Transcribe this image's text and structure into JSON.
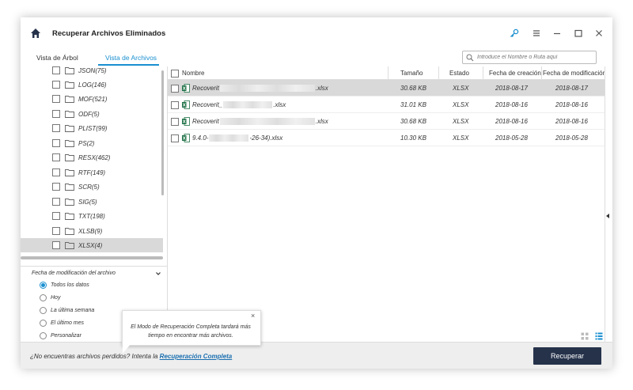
{
  "window": {
    "title": "Recuperar Archivos Eliminados",
    "icons": [
      "home-icon",
      "key-icon",
      "menu-icon",
      "minimize-icon",
      "maximize-icon",
      "close-icon"
    ]
  },
  "tabs": [
    {
      "label": "Vista de Árbol",
      "active": false
    },
    {
      "label": "Vista de Archivos",
      "active": true
    }
  ],
  "search": {
    "placeholder": "Introduce el Nombre o Ruta aquí"
  },
  "tree": {
    "items": [
      {
        "label": "JSON(75)"
      },
      {
        "label": "LOG(146)"
      },
      {
        "label": "MOF(521)"
      },
      {
        "label": "ODF(5)"
      },
      {
        "label": "PLIST(99)"
      },
      {
        "label": "PS(2)"
      },
      {
        "label": "RESX(462)"
      },
      {
        "label": "RTF(149)"
      },
      {
        "label": "SCR(5)"
      },
      {
        "label": "SIG(5)"
      },
      {
        "label": "TXT(198)"
      },
      {
        "label": "XLSB(9)"
      },
      {
        "label": "XLSX(4)",
        "selected": true
      }
    ]
  },
  "filter": {
    "title": "Fecha de modificación del archivo",
    "options": [
      {
        "label": "Todos los datos",
        "selected": true
      },
      {
        "label": "Hoy",
        "selected": false
      },
      {
        "label": "La última semana",
        "selected": false
      },
      {
        "label": "El último mes",
        "selected": false
      },
      {
        "label": "Personalizar",
        "selected": false
      }
    ]
  },
  "table": {
    "columns": [
      "Nombre",
      "Tamaño",
      "Estado",
      "Fecha de creación",
      "Fecha de modificación"
    ],
    "rows": [
      {
        "name_start": "Recoverit",
        "name_end": ".xlsx",
        "size": "30.68 KB",
        "status": "XLSX",
        "created": "2018-08-17",
        "modified": "2018-08-17",
        "selected": true
      },
      {
        "name_start": "Recoverit_",
        "name_end": ".xlsx",
        "size": "31.01 KB",
        "status": "XLSX",
        "created": "2018-08-16",
        "modified": "2018-08-16",
        "selected": false
      },
      {
        "name_start": "Recoverit",
        "name_end": ".xlsx",
        "size": "30.68 KB",
        "status": "XLSX",
        "created": "2018-08-16",
        "modified": "2018-08-16",
        "selected": false
      },
      {
        "name_start": "9.4.0-",
        "name_end": "-26-34).xlsx",
        "size": "10.30 KB",
        "status": "XLSX",
        "created": "2018-05-28",
        "modified": "2018-05-28",
        "selected": false
      }
    ]
  },
  "tooltip": {
    "text": "El Modo de Recuperación Completa tardará más tiempo en encontrar más archivos.",
    "close": "×"
  },
  "footer": {
    "question": "¿No encuentras archivos perdidos? Intenta la",
    "link": "Recuperación Completa",
    "recover_button": "Recuperar"
  },
  "colors": {
    "accent": "#1a8fd0",
    "button": "#25324a",
    "excel": "#1e7145"
  }
}
